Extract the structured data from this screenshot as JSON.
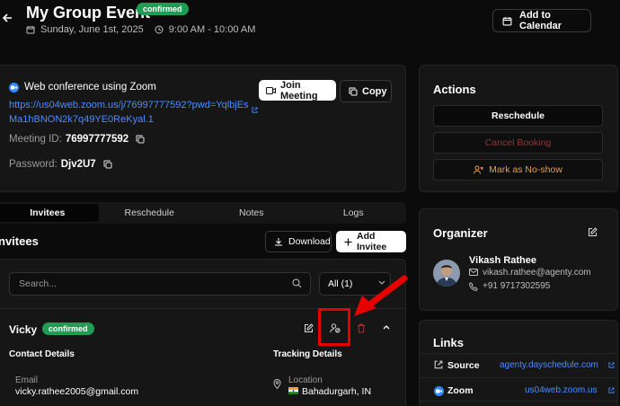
{
  "header": {
    "title": "My Group Event",
    "status_badge": "confirmed",
    "date": "Sunday, June 1st, 2025",
    "time": "9:00 AM - 10:00 AM",
    "add_to_calendar": "Add to Calendar"
  },
  "conference": {
    "provider_line": "Web conference using Zoom",
    "link": "https://us04web.zoom.us/j/76997777592?pwd=YqlbjEsMa1hBNON2k7q49YE0ReKyal.1",
    "join_button": "Join Meeting",
    "copy_button": "Copy",
    "meeting_id_label": "Meeting ID:",
    "meeting_id": "76997777592",
    "password_label": "Password:",
    "password": "Djv2U7"
  },
  "tabs": [
    {
      "label": "Invitees",
      "active": true
    },
    {
      "label": "Reschedule",
      "active": false
    },
    {
      "label": "Notes",
      "active": false
    },
    {
      "label": "Logs",
      "active": false
    }
  ],
  "invitees": {
    "title": "nvitees",
    "download_button": "Download",
    "add_button": "Add Invitee",
    "search_placeholder": "Search...",
    "filter_value": "All (1)",
    "invitee": {
      "name": "Vicky",
      "status": "confirmed",
      "contact_heading": "Contact Details",
      "tracking_heading": "Tracking Details",
      "email_label": "Email",
      "email": "vicky.rathee2005@gmail.com",
      "location_label": "Location",
      "location": "Bahadurgarh, IN"
    }
  },
  "actions": {
    "title": "Actions",
    "reschedule": "Reschedule",
    "cancel": "Cancel Booking",
    "no_show": "Mark as No-show"
  },
  "organizer": {
    "title": "Organizer",
    "name": "Vikash Rathee",
    "email": "vikash.rathee@agenty.com",
    "phone": "+91 9717302595"
  },
  "links": {
    "title": "Links",
    "items": [
      {
        "label": "Source",
        "url": "agenty.dayschedule.com",
        "icon": "external-link-icon"
      },
      {
        "label": "Zoom",
        "url": "us04web.zoom.us",
        "icon": "zoom-icon"
      }
    ]
  },
  "colors": {
    "badge_green": "#1f9d55",
    "link_blue": "#4b8dff",
    "cancel_red": "#8a3a3a",
    "noshow_orange": "#e8a040",
    "annotation_red": "#e60000"
  }
}
